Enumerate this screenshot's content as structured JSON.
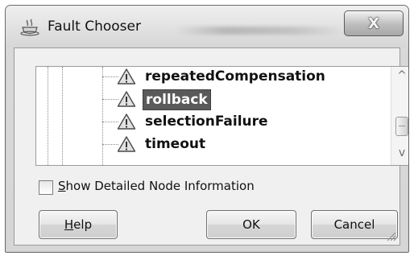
{
  "window": {
    "title": "Fault Chooser",
    "title_icon": "coffee-cup-icon",
    "close_glyph": "X"
  },
  "tree": {
    "items": [
      {
        "label": "repeatedCompensation",
        "icon": "warning-triangle-icon",
        "selected": false
      },
      {
        "label": "rollback",
        "icon": "warning-triangle-icon",
        "selected": true
      },
      {
        "label": "selectionFailure",
        "icon": "warning-triangle-icon",
        "selected": false
      },
      {
        "label": "timeout",
        "icon": "warning-triangle-icon",
        "selected": false
      }
    ],
    "scroll_up_glyph": "^",
    "scroll_down_glyph": "v"
  },
  "checkbox": {
    "mnemonic": "S",
    "label_rest": "how Detailed Node Information",
    "checked": false
  },
  "buttons": {
    "help_mnemonic": "H",
    "help_rest": "elp",
    "ok": "OK",
    "cancel": "Cancel"
  }
}
